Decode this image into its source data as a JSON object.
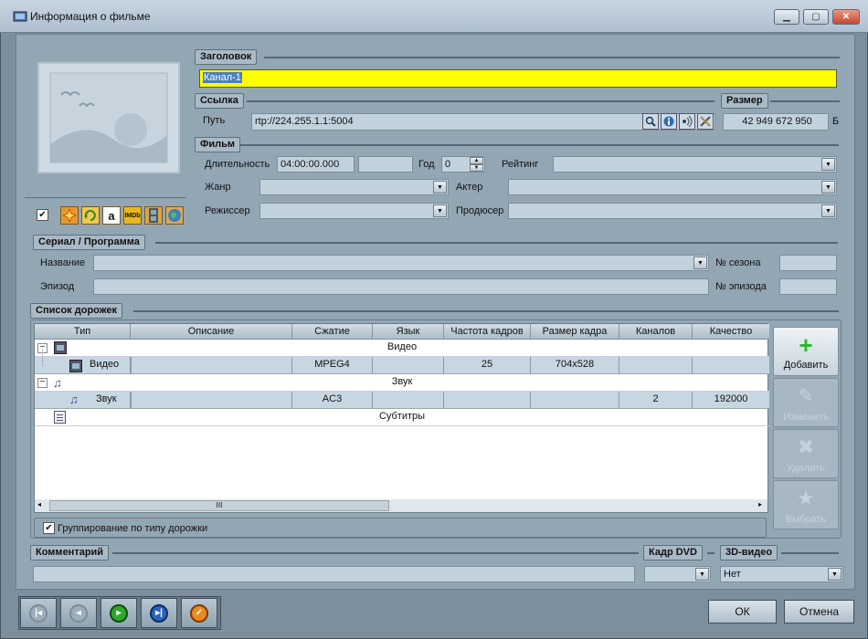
{
  "window": {
    "title": "Информация о фильме",
    "min_icon": "minimize-icon",
    "max_icon": "maximize-icon",
    "close_label": "✕"
  },
  "header_section": {
    "label": "Заголовок",
    "value": "Канал-1",
    "highlight": "#ffff00"
  },
  "link_section": {
    "label": "Ссылка",
    "path_label": "Путь",
    "path_value": "rtp://224.255.1.1:5004"
  },
  "size_section": {
    "label": "Размер",
    "value": "42 949 672 950",
    "unit": "Б"
  },
  "film_section": {
    "label": "Фильм",
    "duration_label": "Длительность",
    "duration_value": "04:00:00.000",
    "duration_extra": "",
    "year_label": "Год",
    "year_value": "0",
    "rating_label": "Рейтинг",
    "rating_value": "",
    "genre_label": "Жанр",
    "genre_value": "",
    "actor_label": "Актер",
    "actor_value": "",
    "director_label": "Режиссер",
    "director_value": "",
    "producer_label": "Продюсер",
    "producer_value": ""
  },
  "sources": {
    "checked": true,
    "icons": [
      "sparkle-icon",
      "refresh-icon",
      "amazon-icon",
      "imdb-icon",
      "film-icon",
      "globe-icon"
    ],
    "amazon_glyph": "a",
    "imdb_glyph": "IMDb"
  },
  "series_section": {
    "label": "Сериал / Программа",
    "name_label": "Название",
    "name_value": "",
    "season_label": "№ сезона",
    "season_value": "",
    "episode_label": "Эпизод",
    "episode_value": "",
    "episode_no_label": "№ эпизода",
    "episode_no_value": ""
  },
  "tracks_section": {
    "label": "Список дорожек",
    "columns": [
      "Тип",
      "Описание",
      "Сжатие",
      "Язык",
      "Частота кадров",
      "Размер кадра",
      "Каналов",
      "Качество"
    ],
    "groups": {
      "video": "Видео",
      "audio": "Звук",
      "subs": "Субтитры"
    },
    "video_row": {
      "type": "Видео",
      "desc": "",
      "codec": "MPEG4",
      "lang": "",
      "fps": "25",
      "frame": "704x528",
      "channels": "",
      "quality": ""
    },
    "audio_row": {
      "type": "Звук",
      "desc": "",
      "codec": "AC3",
      "lang": "",
      "fps": "",
      "frame": "",
      "channels": "2",
      "quality": "192000"
    },
    "scroll_thumb": "III",
    "group_by_label": "Группирование по типу дорожки",
    "group_by_checked": true,
    "buttons": {
      "add": "Добавить",
      "edit": "Изменить",
      "delete": "Удалить",
      "select": "Выбрать"
    }
  },
  "comment_section": {
    "label": "Комментарий",
    "value": ""
  },
  "dvd_section": {
    "label": "Кадр DVD",
    "value": ""
  },
  "threed_section": {
    "label": "3D-видео",
    "value": "Нет"
  },
  "footer": {
    "ok": "ОК",
    "cancel": "Отмена",
    "nav_icons": [
      "first-icon",
      "prev-icon",
      "next-icon",
      "last-icon",
      "apply-icon"
    ]
  }
}
